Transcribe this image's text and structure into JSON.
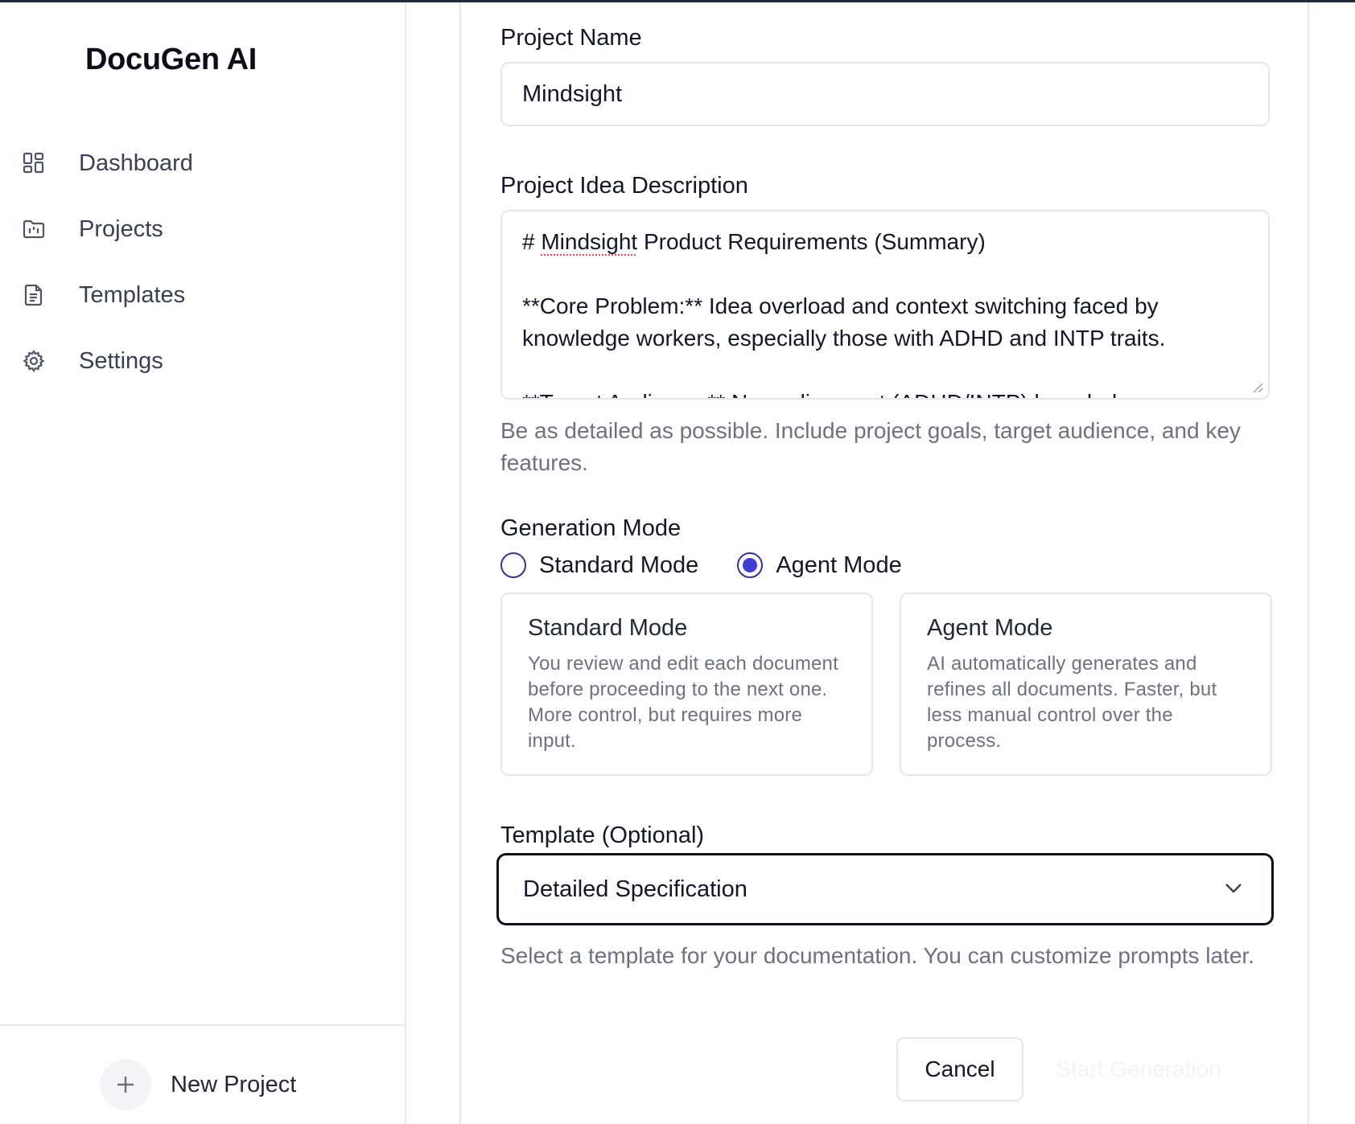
{
  "app": {
    "brand": "DocuGen AI"
  },
  "sidebar": {
    "items": [
      {
        "label": "Dashboard",
        "icon": "dashboard-icon"
      },
      {
        "label": "Projects",
        "icon": "folder-icon"
      },
      {
        "label": "Templates",
        "icon": "document-icon"
      },
      {
        "label": "Settings",
        "icon": "gear-icon"
      }
    ],
    "new_project_label": "New Project"
  },
  "form": {
    "project_name": {
      "label": "Project Name",
      "value": "Mindsight"
    },
    "description": {
      "label": "Project Idea Description",
      "line1_prefix": "# ",
      "line1_word": "Mindsight",
      "line1_rest": " Product Requirements (Summary)",
      "line2": "**Core Problem:** Idea overload and context switching faced by",
      "line3": "knowledge workers, especially those with ADHD and INTP traits.",
      "line4": "**Target Audience:** Neurodivergent (ADHD/INTP) knowledge",
      "helper": "Be as detailed as possible. Include project goals, target audience, and key features."
    },
    "generation_mode": {
      "label": "Generation Mode",
      "selected": "agent",
      "options": [
        {
          "label": "Standard Mode",
          "checked": false
        },
        {
          "label": "Agent Mode",
          "checked": true
        }
      ],
      "cards": [
        {
          "title": "Standard Mode",
          "desc": "You review and edit each document before proceeding to the next one. More control, but requires more input."
        },
        {
          "title": "Agent Mode",
          "desc": "AI automatically generates and refines all documents. Faster, but less manual control over the process."
        }
      ]
    },
    "template": {
      "label": "Template (Optional)",
      "value": "Detailed Specification",
      "helper": "Select a template for your documentation. You can customize prompts later."
    },
    "actions": {
      "cancel": "Cancel",
      "start": "Start Generation"
    }
  },
  "colors": {
    "accent": "#3b3fd8",
    "border": "#e5e7eb",
    "muted": "#6b7280"
  }
}
